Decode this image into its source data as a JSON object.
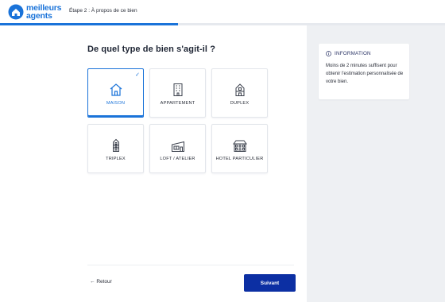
{
  "header": {
    "logo_line1": "meilleurs",
    "logo_line2": "agents",
    "step_label": "Étape 2 : À propos de ce bien"
  },
  "progress": {
    "value": 0.4
  },
  "main": {
    "question": "De quel type de bien s'agit-il ?",
    "types": [
      {
        "label": "MAISON",
        "icon": "house-icon",
        "selected": true
      },
      {
        "label": "APPARTEMENT",
        "icon": "apartment-building-icon",
        "selected": false
      },
      {
        "label": "DUPLEX",
        "icon": "duplex-icon",
        "selected": false
      },
      {
        "label": "TRIPLEX",
        "icon": "triplex-icon",
        "selected": false
      },
      {
        "label": "LOFT / ATELIER",
        "icon": "loft-icon",
        "selected": false
      },
      {
        "label": "HOTEL PARTICULIER",
        "icon": "mansion-icon",
        "selected": false
      }
    ],
    "back_label": "Retour",
    "next_label": "Suivant"
  },
  "aside": {
    "info_title": "INFORMATION",
    "info_text": "Moins de 2 minutes suffisent pour obtenir l'estimation personnalisée de votre bien."
  },
  "colors": {
    "accent": "#1a73d9",
    "primary_button": "#0c2fa3",
    "aside_bg": "#eef0f3"
  }
}
